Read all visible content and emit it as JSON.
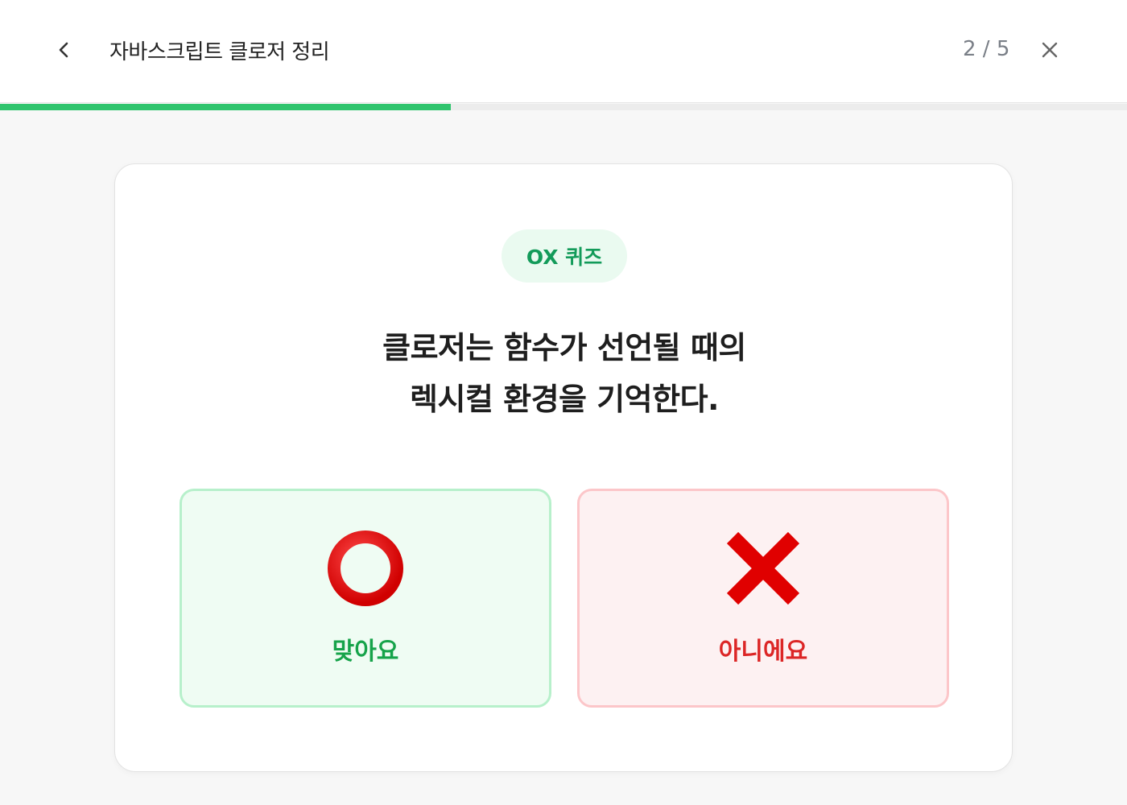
{
  "header": {
    "title": "자바스크립트 클로저 정리",
    "counter": "2 / 5",
    "back_icon": "chevron-left-icon",
    "close_icon": "close-icon"
  },
  "progress": {
    "fraction": 0.4,
    "color": "#2fc46d"
  },
  "quiz": {
    "badge": "OX 퀴즈",
    "question_line1": "클로저는 함수가 선언될 때의",
    "question_line2": "렉시컬 환경을 기억한다.",
    "answers": [
      {
        "label": "맞아요",
        "icon": "circle-o-icon",
        "color": "#16a34a"
      },
      {
        "label": "아니에요",
        "icon": "cross-x-icon",
        "color": "#dc2626"
      }
    ]
  }
}
